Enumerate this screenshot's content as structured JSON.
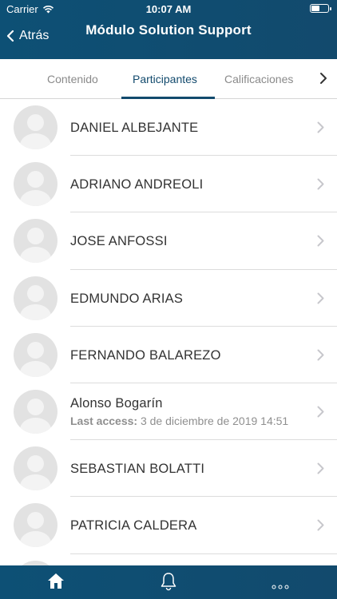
{
  "status_bar": {
    "carrier": "Carrier",
    "time": "10:07 AM",
    "battery_level": 0.5
  },
  "nav": {
    "back_label": "Atrás",
    "title": "Módulo Solution Support"
  },
  "tabs": [
    {
      "label": "Contenido"
    },
    {
      "label": "Participantes"
    },
    {
      "label": "Calificaciones"
    }
  ],
  "participants": [
    {
      "name": "DANIEL ALBEJANTE"
    },
    {
      "name": "ADRIANO ANDREOLI"
    },
    {
      "name": "JOSE ANFOSSI"
    },
    {
      "name": "EDMUNDO ARIAS"
    },
    {
      "name": "FERNANDO BALAREZO"
    },
    {
      "name": "Alonso Bogarín",
      "last_access_label": "Last access:",
      "last_access_value": "3 de diciembre de 2019 14:51"
    },
    {
      "name": "SEBASTIAN BOLATTI"
    },
    {
      "name": "PATRICIA CALDERA"
    }
  ],
  "colors": {
    "brand": "#124a6d",
    "text": "#333333",
    "muted": "#8f8f8f"
  },
  "icons": {
    "home": "home-icon",
    "notifications": "bell-icon",
    "more": "more-icon"
  }
}
